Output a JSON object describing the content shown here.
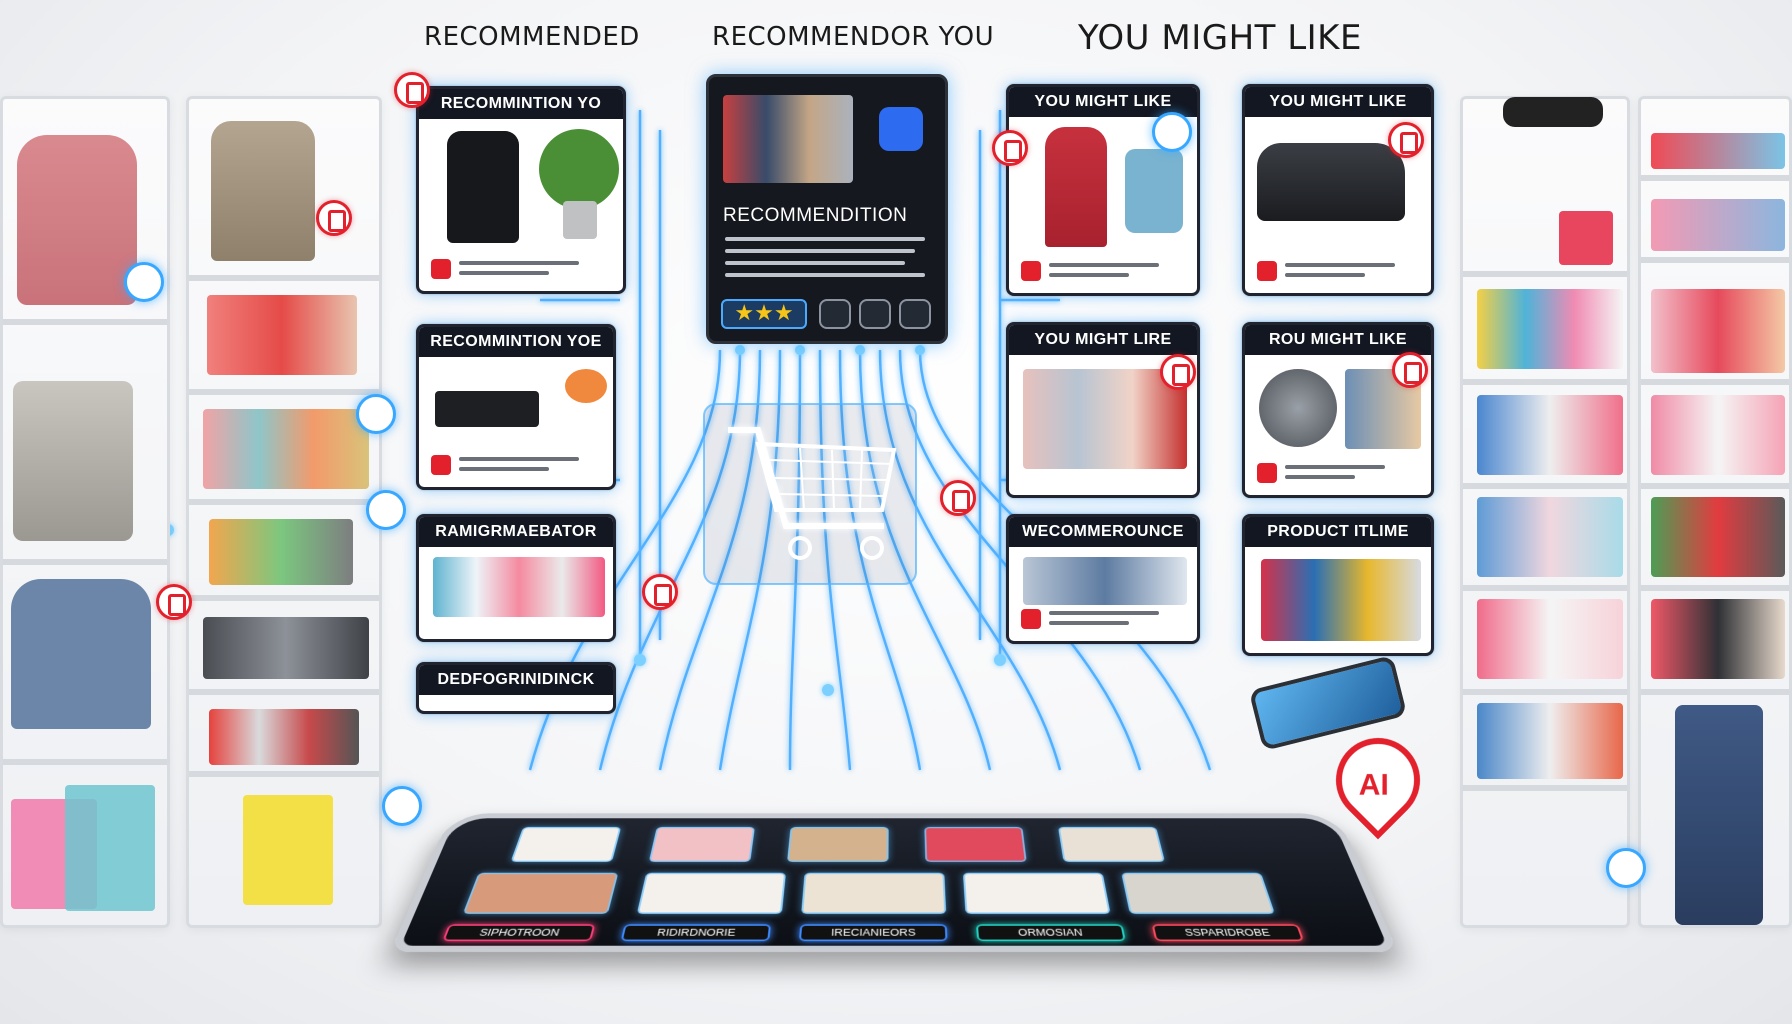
{
  "headings": {
    "left": "RECOMMENDED",
    "center": "RECOMMENDOR YOU",
    "right": "YOU  MIGHT LIKE"
  },
  "cards": {
    "left_top": "RECOMMINTION YO",
    "left_mid": "RECOMMINTION YOE",
    "left_low": "RAMIGRMAEBATOR",
    "left_bottom": "DEDFOGRINIDINCK",
    "right_a_top": "YOU MIGHT LIKE",
    "right_b_top": "YOU MIGHT LIKE",
    "right_a_mid": "YOU MIGHT LIRE",
    "right_b_mid": "ROU MIGHT LIKE",
    "right_a_low": "WECOMMEROUNCE",
    "right_b_low": "PRODUCT ITLIME"
  },
  "center_panel": {
    "title": "RECOMMENDITION",
    "stars": "★★★"
  },
  "tablet": {
    "pills": [
      "SIPHOTROON",
      "RIDIRDNORIE",
      "IRECIANIEORS",
      "ORMOSIAN",
      "SSPARIDROBE"
    ]
  },
  "ai_badge": "AI",
  "colors": {
    "accent_red": "#e3212c",
    "glow_blue": "#37a7ff",
    "panel_dark": "#15191f"
  }
}
